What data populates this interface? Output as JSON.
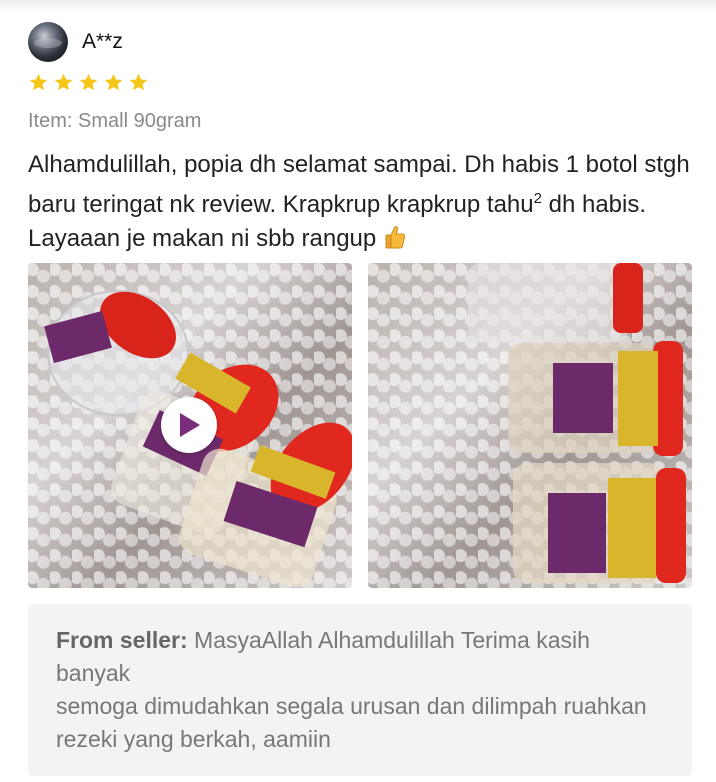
{
  "reviewer": {
    "name": "A**z",
    "rating": 5
  },
  "item_variation": "Item: Small 90gram",
  "review": {
    "text_part1": "Alhamdulillah, popia dh selamat sampai. Dh habis 1 botol stgh baru teringat nk review. Krapkrup krapkrup tahu",
    "superscript": "2",
    "text_part2": " dh habis. Layaaan je makan ni sbb rangup "
  },
  "media": [
    {
      "type": "video",
      "icon": "play-icon"
    },
    {
      "type": "image"
    }
  ],
  "seller_reply": {
    "label": "From seller:",
    "line1": " MasyaAllah Alhamdulillah Terima kasih banyak",
    "line2": "semoga dimudahkan segala urusan dan dilimpah ruahkan rezeki yang berkah, aamiin"
  },
  "colors": {
    "star": "#f5c518",
    "jar_lid": "#e0281f",
    "label_purple": "#6d2a6b",
    "gold_foil": "#d8b52a"
  }
}
